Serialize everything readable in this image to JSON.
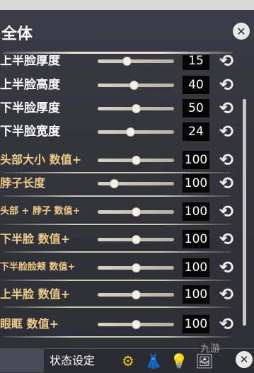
{
  "window": {
    "title": "全体",
    "close_glyph": "✕"
  },
  "sliders": [
    {
      "label": "上半脸厚度",
      "value": "15",
      "level": 0.38,
      "label_color": "white",
      "size": 17
    },
    {
      "label": "上半脸高度",
      "value": "40",
      "level": 0.47,
      "label_color": "white",
      "size": 17
    },
    {
      "label": "下半脸厚度",
      "value": "50",
      "level": 0.5,
      "label_color": "white",
      "size": 17
    },
    {
      "label": "下半脸宽度",
      "value": "24",
      "level": 0.43,
      "label_color": "white",
      "size": 17
    },
    {
      "label": "头部大小 数值+",
      "value": "100",
      "level": 0.5,
      "label_color": "gold",
      "size": 16
    },
    {
      "label": "脖子长度",
      "value": "100",
      "level": 0.21,
      "label_color": "gold",
      "size": 16
    },
    {
      "label": "头部 + 脖子 数值+",
      "value": "100",
      "level": 0.5,
      "label_color": "gold",
      "size": 13
    },
    {
      "label": "下半脸 数值+",
      "value": "100",
      "level": 0.5,
      "label_color": "gold",
      "size": 16
    },
    {
      "label": "下半脸脸颊 数值+",
      "value": "100",
      "level": 0.5,
      "label_color": "gold",
      "size": 13
    },
    {
      "label": "上半脸 数值+",
      "value": "100",
      "level": 0.5,
      "label_color": "gold",
      "size": 16
    },
    {
      "label": "眼眶 数值+",
      "value": "100",
      "level": 0.5,
      "label_color": "gold",
      "size": 16
    }
  ],
  "reset_glyph": "⟲",
  "statusbar": {
    "label": "状态设定",
    "icons": [
      {
        "name": "gear-icon",
        "glyph": "⚙",
        "color": "#e8c820"
      },
      {
        "name": "dress-icon",
        "glyph": "👗",
        "color": "#e0e0e0"
      },
      {
        "name": "bulb-icon",
        "glyph": "💡",
        "color": "#e0e0e0"
      },
      {
        "name": "picture-icon",
        "glyph": "🖼",
        "color": "#e0e0e0"
      }
    ],
    "close_glyph": "✕"
  },
  "watermark": "九游"
}
